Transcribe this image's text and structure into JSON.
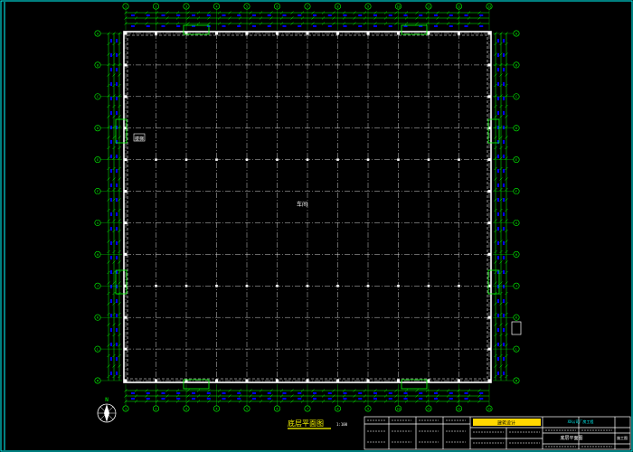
{
  "drawing": {
    "title": "底层平面图",
    "title_scale": "1:100",
    "hall_label": "车间",
    "side_tag": "楼梯",
    "grid_cols": [
      "1",
      "2",
      "3",
      "4",
      "5",
      "6",
      "7",
      "8",
      "9",
      "10",
      "11",
      "12",
      "13"
    ],
    "grid_rows": [
      "A",
      "B",
      "C",
      "D",
      "E",
      "F",
      "G",
      "H",
      "J",
      "K",
      "L",
      "M"
    ],
    "north_label": "N"
  },
  "title_block": {
    "project_name": "XX公司厂房工程",
    "drawing_name": "底层平面图",
    "company_badge": "建筑设计",
    "design_stage": "施工图"
  },
  "colors": {
    "background": "#000000",
    "frame": "#00ffff",
    "grid": "#ffffff",
    "dimension": "#00ff00",
    "blue_marks": "#0000ff",
    "title_block": "#ffffff",
    "badge": "#ffd700"
  }
}
